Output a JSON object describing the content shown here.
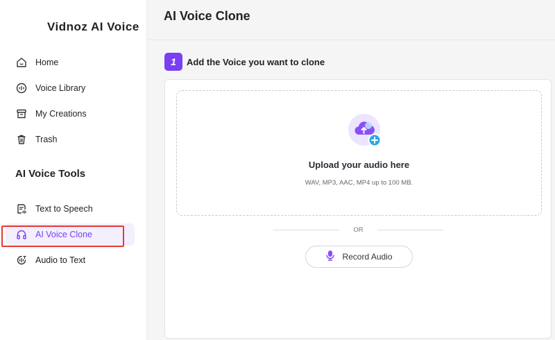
{
  "app": {
    "name": "Vidnoz AI Voice"
  },
  "sidebar": {
    "items": [
      {
        "label": "Home",
        "icon": "home-icon"
      },
      {
        "label": "Voice Library",
        "icon": "voice-library-icon"
      },
      {
        "label": "My Creations",
        "icon": "archive-box-icon"
      },
      {
        "label": "Trash",
        "icon": "trash-icon"
      }
    ],
    "section_title": "AI Voice Tools",
    "tools": [
      {
        "label": "Text to Speech",
        "icon": "text-to-speech-icon"
      },
      {
        "label": "AI Voice Clone",
        "icon": "headphones-icon",
        "active": true
      },
      {
        "label": "Audio to Text",
        "icon": "audio-to-text-icon"
      }
    ]
  },
  "main": {
    "title": "AI Voice Clone",
    "step": {
      "number": "1",
      "label": "Add the Voice you want to clone"
    },
    "upload": {
      "title": "Upload your audio here",
      "subtitle": "WAV, MP3, AAC, MP4 up to 100 MB.",
      "icon": "cloud-upload-icon"
    },
    "divider_text": "OR",
    "record_button": {
      "label": "Record Audio",
      "icon": "microphone-icon"
    }
  },
  "colors": {
    "accent": "#7a3ff2",
    "active_bg": "#f3efff",
    "highlight_border": "#e53935",
    "upload_plus": "#2aa8e0"
  }
}
